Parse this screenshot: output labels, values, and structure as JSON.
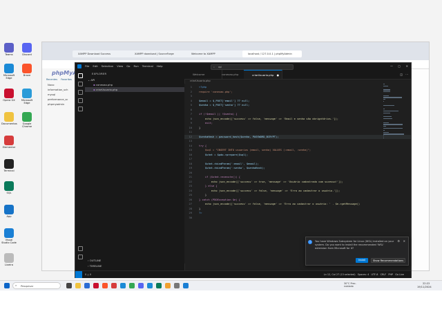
{
  "desktop_icons": [
    {
      "label": "Teams",
      "color": "#5b5fc7"
    },
    {
      "label": "Discord",
      "color": "#5865f2"
    },
    {
      "label": "Microsoft Edge",
      "color": "#1b8ad6"
    },
    {
      "label": "Brave",
      "color": "#fb542b"
    },
    {
      "label": "Opera GX",
      "color": "#c9102f"
    },
    {
      "label": "Microsoft Edge",
      "color": "#2a9bd8"
    },
    {
      "label": "Documentos",
      "color": "#f0c340"
    },
    {
      "label": "Google Chrome",
      "color": "#34a853"
    },
    {
      "label": "Elementor",
      "color": "#d63c3c"
    },
    {
      "label": "Terminal",
      "color": "#222222"
    },
    {
      "label": "SQL",
      "color": "#0a7a5a"
    },
    {
      "label": "App",
      "color": "#1673c7"
    },
    {
      "label": "Visual Studio Code",
      "color": "#1a7fd4"
    },
    {
      "label": "Lixeira",
      "color": "#bbbbbb"
    }
  ],
  "browser": {
    "tabs": [
      "XAMPP Download Success",
      "XAMPP download | SourceForge",
      "Welcome to XAMPP",
      "localhost / 127.0.0.1 | phpMyAdmin"
    ],
    "address": "localhost",
    "pma": {
      "logo": "phpMyA",
      "links": [
        "Recentes",
        "Favoritas"
      ],
      "tree": [
        "Novo",
        "information_sch",
        "mysql",
        "performance_sc",
        "phpmyadmin"
      ]
    }
  },
  "vscode": {
    "menu": [
      "File",
      "Edit",
      "Selection",
      "View",
      "Go",
      "Run",
      "Terminal",
      "Help"
    ],
    "search": "api",
    "explorer_title": "EXPLORER",
    "folder": "API",
    "files": [
      "conexao.php",
      "criarUsuario.php"
    ],
    "outline": "OUTLINE",
    "timeline": "TIMELINE",
    "tabs": [
      "Welcome",
      "conexao.php",
      "criarUsuario.php"
    ],
    "breadcrumb": "criarUsuario.php",
    "code": [
      {
        "n": "1",
        "t": "<?php",
        "c": "#569cd6"
      },
      {
        "n": "2",
        "t": "require 'conexao.php';",
        "c": "#ce9178"
      },
      {
        "n": "3",
        "t": "",
        "c": "#d4d4d4"
      },
      {
        "n": "4",
        "t": "$email = $_POST['email'] ?? null;",
        "c": "#9cdcfe"
      },
      {
        "n": "5",
        "t": "$senha = $_POST['senha'] ?? null;",
        "c": "#9cdcfe"
      },
      {
        "n": "6",
        "t": "",
        "c": "#d4d4d4"
      },
      {
        "n": "7",
        "t": "if (!$email || !$senha) {",
        "c": "#c586c0"
      },
      {
        "n": "8",
        "t": "    echo json_encode(['success' => false, 'message' => 'Email e senha são obrigatórios.']);",
        "c": "#dcdcaa"
      },
      {
        "n": "9",
        "t": "    exit;",
        "c": "#c586c0"
      },
      {
        "n": "10",
        "t": "}",
        "c": "#d4d4d4"
      },
      {
        "n": "11",
        "t": "",
        "c": "#d4d4d4"
      },
      {
        "n": "12",
        "t": "$senhaHash = password_hash($senha, PASSWORD_BCRYPT);",
        "c": "#9cdcfe"
      },
      {
        "n": "13",
        "t": "",
        "c": "#d4d4d4"
      },
      {
        "n": "14",
        "t": "try {",
        "c": "#c586c0"
      },
      {
        "n": "15",
        "t": "    $sql = \"INSERT INTO usuarios (email, senha) VALUES (:email, :senha)\";",
        "c": "#ce9178"
      },
      {
        "n": "16",
        "t": "    $stmt = $pdo->prepare($sql);",
        "c": "#9cdcfe"
      },
      {
        "n": "17",
        "t": "",
        "c": "#d4d4d4"
      },
      {
        "n": "18",
        "t": "    $stmt->bindParam(':email', $email);",
        "c": "#9cdcfe"
      },
      {
        "n": "19",
        "t": "    $stmt->bindParam(':senha', $senhaHash);",
        "c": "#9cdcfe"
      },
      {
        "n": "20",
        "t": "",
        "c": "#d4d4d4"
      },
      {
        "n": "21",
        "t": "    if ($stmt->execute()) {",
        "c": "#c586c0"
      },
      {
        "n": "22",
        "t": "        echo json_encode(['success' => true, 'message' => 'Usuário cadastrado com sucesso!']);",
        "c": "#dcdcaa"
      },
      {
        "n": "23",
        "t": "    } else {",
        "c": "#c586c0"
      },
      {
        "n": "24",
        "t": "        echo json_encode(['success' => false, 'message' => 'Erro ao cadastrar o usuário.']);",
        "c": "#dcdcaa"
      },
      {
        "n": "25",
        "t": "    }",
        "c": "#d4d4d4"
      },
      {
        "n": "26",
        "t": "} catch (PDOException $e) {",
        "c": "#c586c0"
      },
      {
        "n": "27",
        "t": "    echo json_encode(['success' => false, 'message' => 'Erro ao cadastrar o usuário: ' . $e->getMessage()",
        "c": "#dcdcaa"
      },
      {
        "n": "28",
        "t": "}",
        "c": "#d4d4d4"
      },
      {
        "n": "29",
        "t": "?>",
        "c": "#569cd6"
      },
      {
        "n": "30",
        "t": "",
        "c": "#d4d4d4"
      }
    ],
    "status_left": "0 △ 0",
    "status_right": "Ln 12, Col 27 (13 selected)   Spaces: 4   UTF-8   CRLF   PHP   Go Live",
    "notification": {
      "text": "You have Windows Subsystem for Linux (WSL) installed on your system. Do you want to install the recommended 'WSL' extension from Microsoft for it?",
      "install": "Install",
      "show": "Show Recommendations"
    }
  },
  "taskbar": {
    "search": "Pesquisar",
    "weather": "30°C Prec. nublado",
    "time": "22:22",
    "date": "19/11/2024"
  }
}
